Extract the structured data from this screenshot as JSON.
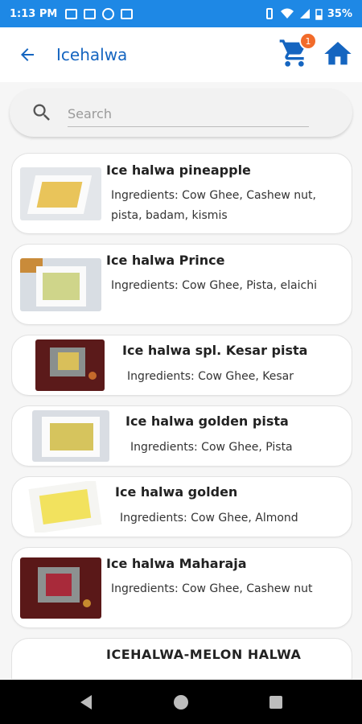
{
  "status_bar": {
    "time": "1:13 PM",
    "battery": "35%"
  },
  "app_bar": {
    "title": "Icehalwa",
    "cart_count": "1"
  },
  "search": {
    "placeholder": "Search"
  },
  "products": [
    {
      "name": "Ice halwa pineapple",
      "ingredients": "Ingredients: Cow Ghee, Cashew nut, pista, badam, kismis",
      "image": "white plate with golden pineapple halwa on light background"
    },
    {
      "name": "Ice halwa Prince",
      "ingredients": "Ingredients: Cow Ghee, Pista, elaichi",
      "image": "white plate with pale green pista halwa"
    },
    {
      "name": "Ice halwa spl. Kesar pista",
      "ingredients": "Ingredients: Cow Ghee, Kesar",
      "image": "halwa on tray over dark maroon background"
    },
    {
      "name": "Ice halwa golden pista",
      "ingredients": "Ingredients: Cow Ghee, Pista",
      "image": "white plate with golden pista halwa"
    },
    {
      "name": "Ice halwa golden",
      "ingredients": "Ingredients: Cow Ghee, Almond",
      "image": "white plate with yellow golden halwa"
    },
    {
      "name": "Ice halwa Maharaja",
      "ingredients": "Ingredients: Cow Ghee, Cashew nut",
      "image": "red halwa on tray over dark maroon background"
    },
    {
      "name": "ICEHALWA-MELON HALWA",
      "ingredients": "",
      "image": ""
    }
  ],
  "colors": {
    "status_bar": "#1e88e5",
    "title": "#1565c0",
    "badge": "#f26b2a",
    "home": "#1565c0"
  }
}
